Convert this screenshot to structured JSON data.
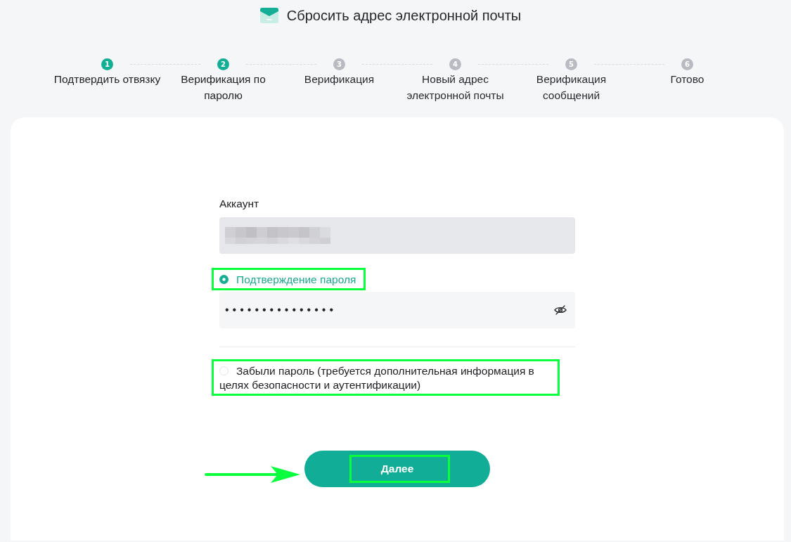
{
  "header": {
    "title": "Сбросить адрес электронной почты"
  },
  "steps": [
    {
      "number": "1",
      "label": "Подтвердить отвязку",
      "active": true
    },
    {
      "number": "2",
      "label": "Верификация по паролю",
      "active": true
    },
    {
      "number": "3",
      "label": "Верификация",
      "active": false
    },
    {
      "number": "4",
      "label": "Новый адрес электронной почты",
      "active": false
    },
    {
      "number": "5",
      "label": "Верификация сообщений",
      "active": false
    },
    {
      "number": "6",
      "label": "Готово",
      "active": false
    }
  ],
  "form": {
    "account": {
      "label": "Аккаунт",
      "disabled": true,
      "redacted": true
    },
    "options": [
      {
        "kind": "password",
        "label": "Подтверждение пароля",
        "selected": true,
        "highlighted": true,
        "password": {
          "value": "•••••••••••••••"
        }
      },
      {
        "kind": "plain",
        "label": "Забыли пароль (требуется дополнительная информация в целях безопасности и аутентификации)",
        "selected": false,
        "highlighted": true
      }
    ],
    "next_button": {
      "label": "Далее",
      "highlighted": true,
      "arrow": true
    }
  }
}
